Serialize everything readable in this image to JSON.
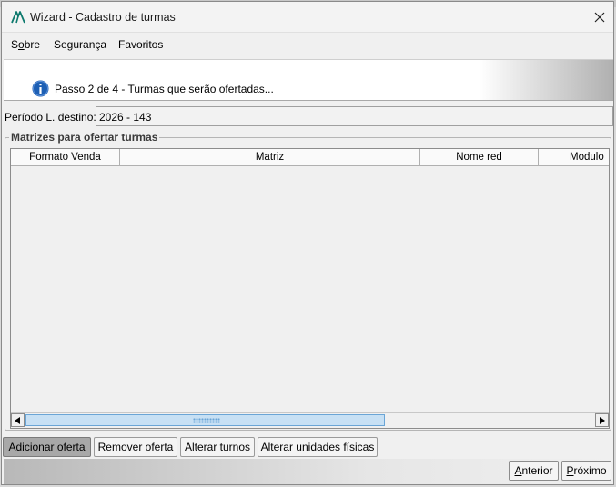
{
  "window": {
    "title": "Wizard - Cadastro de turmas",
    "app_icon": "mountain-logo-icon",
    "close_icon": "close-icon"
  },
  "menu": {
    "items": [
      {
        "label": "Sobre",
        "mnemonic_index": 1
      },
      {
        "label": "Segurança"
      },
      {
        "label": "Favoritos"
      }
    ]
  },
  "banner": {
    "icon": "info-icon",
    "text": "Passo 2 de 4 - Turmas que serão ofertadas..."
  },
  "period": {
    "label": "Período L. destino:",
    "value": "2026 - 143"
  },
  "group": {
    "title": "Matrizes para ofertar turmas"
  },
  "table": {
    "columns": [
      "Formato Venda",
      "Matriz",
      "Nome red",
      "Modulo"
    ],
    "rows": []
  },
  "actions": {
    "add_offer": "Adicionar oferta",
    "remove_offer": "Remover oferta",
    "change_shifts": "Alterar turnos",
    "change_units": "Alterar unidades físicas"
  },
  "navigation": {
    "previous": "Anterior",
    "next": "Próximo"
  },
  "colors": {
    "info_blue": "#1d5fb4",
    "scroll_thumb": "#c7e0f4",
    "active_button": "#a8a8a8"
  }
}
